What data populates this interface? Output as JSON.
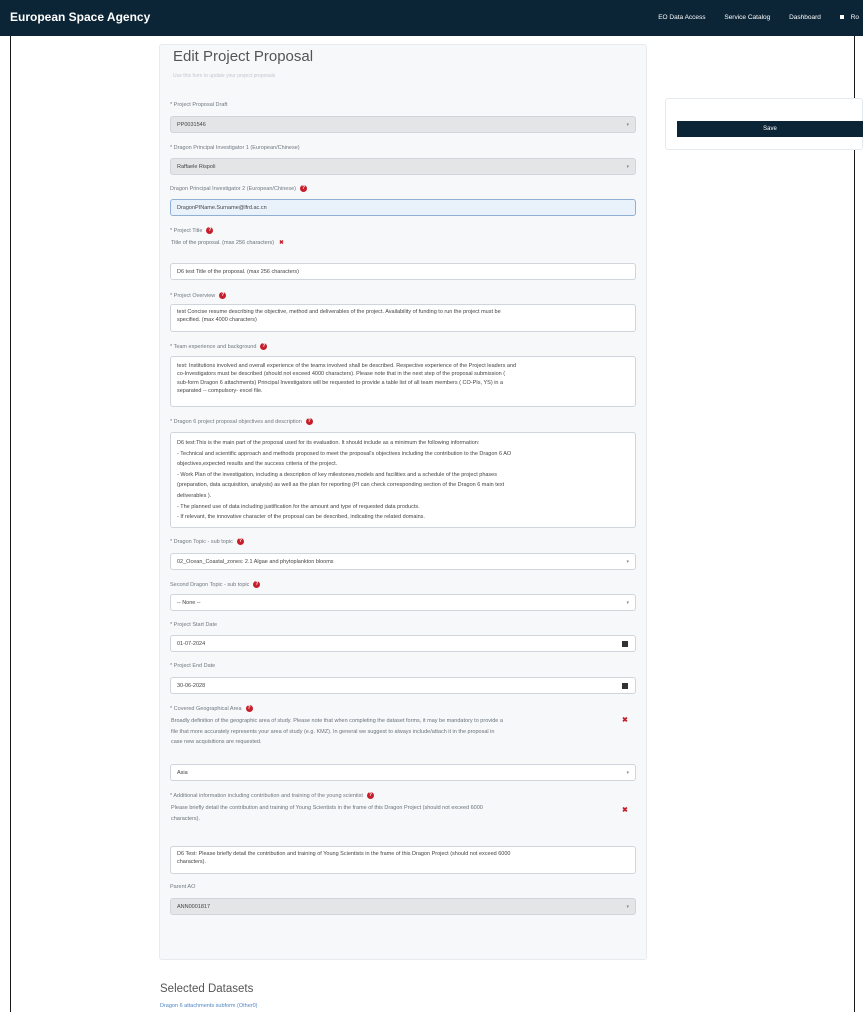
{
  "topbar": {
    "brand": "European Space Agency",
    "nav": [
      "EO Data Access",
      "Service Catalog",
      "Dashboard"
    ],
    "user_initials": "Ro"
  },
  "page": {
    "title": "Edit Project Proposal",
    "subtitle": "Use this form to update your project proposals"
  },
  "form": {
    "proposal_draft": {
      "label": "* Project Proposal Draft",
      "value": "PP0031546"
    },
    "pi1": {
      "label": "* Dragon Principal Investigator 1 (European/Chinese)",
      "value": "Raffaele Rispoli"
    },
    "pi2": {
      "label": "Dragon Principal Investigator 2 (European/Chinese)",
      "value": "DragonPIName.Surname@lfrd.ac.cn"
    },
    "title": {
      "label": "* Project Title",
      "hint": "Title of the proposal. (max 256 characters)",
      "value": "D6 test Title of the proposal. (max 256 characters)"
    },
    "overview": {
      "label": "* Project Overview",
      "lines": [
        "test Concise resume describing the objective, method and deliverables of the project. Availability of funding to run the project must be",
        "specified. (max 4000 characters)"
      ]
    },
    "team": {
      "label": "* Team experience and background",
      "lines": [
        "test: Institutions involved and overall experience of the teams involved shall be described. Respective experience of the Project leaders and",
        "co-Investigators must be described (should not exceed 4000 characters). Please note that in the next step of the proposal submission (",
        "sub-form Dragon 6 attachments) Principal Investigators will be requested to provide a table list of all team members ( CO-PIs, YS) in a",
        "separated -- compulsory- excel file."
      ]
    },
    "objectives": {
      "label": "* Dragon 6 project proposal objectives and description",
      "lines": [
        "D6 test:This is the main part of the proposal used for its evaluation. It should include as a minimum the following information:",
        "- Technical and scientific approach and methods proposed to meet the proposal's objectives including the contribution to the Dragon 6 AO",
        "objectives,expected results and the success criteria of the project.",
        "- Work Plan of the investigation, including a description of key milestones,models and facilities and a schedule of the project phases",
        "(preparation, data acquisition, analysis) as well as the plan for reporting (PI can check corresponding section of the Dragon 6 main text",
        "deliverables ).",
        "- The planned use of data including justification for the amount and type of requested data products.",
        "- If relevant, the innovative character of the proposal can be described, indicating the related domains."
      ]
    },
    "topic": {
      "label": "* Dragon Topic - sub topic",
      "value": "02_Ocean_Coastal_zones: 2.1 Algae and phytoplankton blooms"
    },
    "topic2": {
      "label": "Second Dragon Topic - sub topic",
      "value": "-- None --"
    },
    "start_date": {
      "label": "* Project Start Date",
      "value": "01-07-2024"
    },
    "end_date": {
      "label": "* Project End Date",
      "value": "30-06-2028"
    },
    "area": {
      "label": "* Covered Geographical Area",
      "info_lines": [
        "Broadly definition of the geographic area of study. Please note that when completing the dataset forms, it may be mandatory to provide a",
        "file that more accurately represents your area of study (e.g. KMZ). In general we suggest to always include/attach it in the proposal in",
        "case new acquisitions are requested."
      ],
      "value": "Asia"
    },
    "additional": {
      "label": "* Additional information including contribution and training of the young scientist",
      "info_lines": [
        "Please briefly detail the contribution and training of Young Scientists in the frame of this Dragon Project (should not exceed 6000",
        "characters)."
      ],
      "lines": [
        "D6 Test: Please briefly detail the contribution and training of Young Scientists in the frame of this Dragon Project (should not exceed 6000",
        "characters)."
      ]
    },
    "parent_ao": {
      "label": "Parent AO",
      "value": "ANN0001817"
    }
  },
  "actions": {
    "save_label": "Save"
  },
  "datasets": {
    "heading": "Selected Datasets",
    "link": "Dragon 6 attachments subform (Other0)"
  }
}
